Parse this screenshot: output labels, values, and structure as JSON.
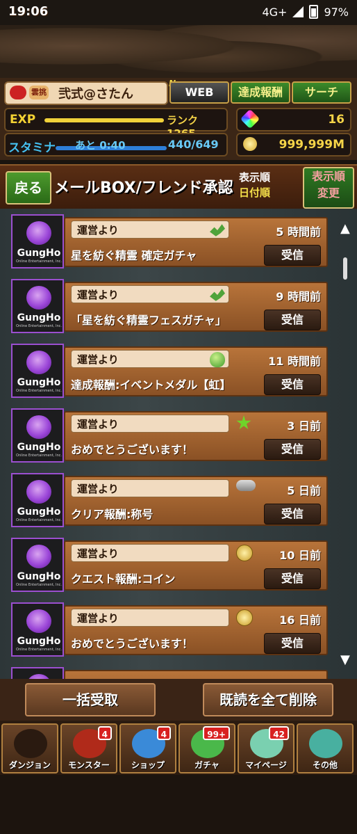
{
  "statusbar": {
    "time": "19:06",
    "network": "4G+",
    "battery": "97%"
  },
  "header": {
    "player_name": "弐式@さたん",
    "rank_tag": "雲挑",
    "new_tag": "New",
    "web_label": "WEB",
    "achievement_label": "達成報酬",
    "search_label": "サーチ",
    "exp_label": "EXP",
    "rank_label": "ランク1265",
    "stamina_label": "スタミナ",
    "stamina_timer": "あと 0:40",
    "stamina_value": "440/649",
    "stones": "16",
    "coins": "999,999M"
  },
  "titlebar": {
    "back_label": "戻る",
    "title": "メールBOX/フレンド承認",
    "sort_label": "表示順",
    "sort_value": "日付順",
    "sort_button_line1": "表示順",
    "sort_button_line2": "変更"
  },
  "mails": [
    {
      "sender": "運営より",
      "icon": "dragon-icon",
      "time": "5 時間前",
      "subject": "星を紡ぐ精霊 確定ガチャ",
      "action": "受信"
    },
    {
      "sender": "運営より",
      "icon": "dragon-icon",
      "time": "9 時間前",
      "subject": "「星を紡ぐ精霊フェスガチャ」",
      "action": "受信"
    },
    {
      "sender": "運営より",
      "icon": "egg-icon",
      "time": "11 時間前",
      "subject": "達成報酬:イベントメダル【虹】",
      "action": "受信"
    },
    {
      "sender": "運営より",
      "icon": "star-icon",
      "time": "3 日前",
      "subject": "おめでとうございます！",
      "action": "受信"
    },
    {
      "sender": "運営より",
      "icon": "title-plate-icon",
      "time": "5 日前",
      "subject": "クリア報酬:称号",
      "action": "受信"
    },
    {
      "sender": "運営より",
      "icon": "coin-icon",
      "time": "10 日前",
      "subject": "クエスト報酬:コイン",
      "action": "受信"
    },
    {
      "sender": "運営より",
      "icon": "coin-icon",
      "time": "16 日前",
      "subject": "おめでとうございます！",
      "action": "受信"
    }
  ],
  "logo": {
    "brand": "GungHo",
    "sub": "Online Entertainment, Inc."
  },
  "bottom": {
    "receive_all": "一括受取",
    "delete_read": "既読を全て削除"
  },
  "nav": [
    {
      "label": "ダンジョン",
      "badge": ""
    },
    {
      "label": "モンスター",
      "badge": "4"
    },
    {
      "label": "ショップ",
      "badge": "4"
    },
    {
      "label": "ガチャ",
      "badge": "99+"
    },
    {
      "label": "マイページ",
      "badge": "42"
    },
    {
      "label": "その他",
      "badge": ""
    }
  ]
}
